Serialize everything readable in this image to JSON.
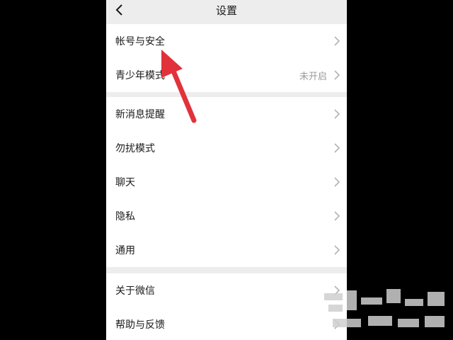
{
  "header": {
    "title": "设置",
    "back_icon": "chevron-left-icon"
  },
  "groups": [
    {
      "items": [
        {
          "label": "帐号与安全",
          "value": ""
        },
        {
          "label": "青少年模式",
          "value": "未开启"
        }
      ]
    },
    {
      "items": [
        {
          "label": "新消息提醒",
          "value": ""
        },
        {
          "label": "勿扰模式",
          "value": ""
        },
        {
          "label": "聊天",
          "value": ""
        },
        {
          "label": "隐私",
          "value": ""
        },
        {
          "label": "通用",
          "value": ""
        }
      ]
    },
    {
      "items": [
        {
          "label": "关于微信",
          "value": ""
        },
        {
          "label": "帮助与反馈",
          "value": ""
        }
      ]
    }
  ],
  "annotation": {
    "color": "#e1323c",
    "icon": "red-arrow-icon"
  },
  "colors": {
    "background": "#ededed",
    "card": "#ffffff",
    "chevron": "#b3b3b3"
  }
}
